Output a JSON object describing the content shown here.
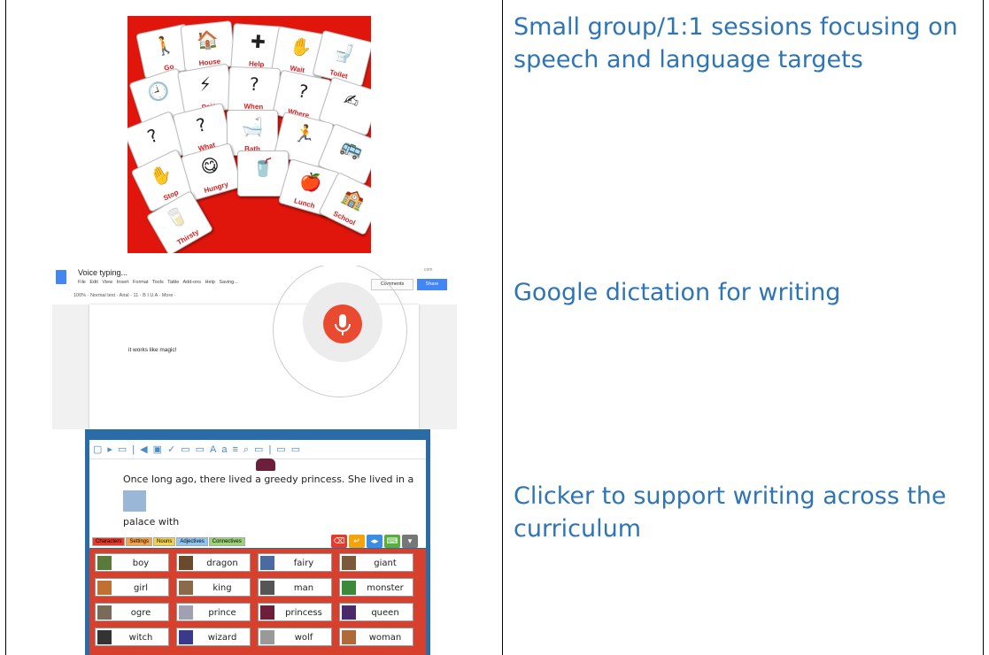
{
  "rows": [
    {
      "caption": "Small group/1:1 sessions focusing on speech and language targets"
    },
    {
      "caption": "Google dictation for writing"
    },
    {
      "caption": "Clicker to support writing across the curriculum"
    }
  ],
  "pecs_cards": [
    {
      "label": "Go",
      "symbol": "🚶"
    },
    {
      "label": "House",
      "symbol": "🏠"
    },
    {
      "label": "Help",
      "symbol": "✚"
    },
    {
      "label": "Wait",
      "symbol": "✋"
    },
    {
      "label": "Toilet",
      "symbol": "🚽"
    },
    {
      "label": "",
      "symbol": "🕘"
    },
    {
      "label": "Pain",
      "symbol": "⚡"
    },
    {
      "label": "When",
      "symbol": "?"
    },
    {
      "label": "Where",
      "symbol": "?"
    },
    {
      "label": "",
      "symbol": "✍"
    },
    {
      "label": "",
      "symbol": "?"
    },
    {
      "label": "What",
      "symbol": "?"
    },
    {
      "label": "Bath",
      "symbol": "🛁"
    },
    {
      "label": "",
      "symbol": "🏃"
    },
    {
      "label": "",
      "symbol": "🚌"
    },
    {
      "label": "Stop",
      "symbol": "✋"
    },
    {
      "label": "Hungry",
      "symbol": "😋"
    },
    {
      "label": "",
      "symbol": "🥤"
    },
    {
      "label": "Lunch",
      "symbol": "🍎"
    },
    {
      "label": "School",
      "symbol": "🏫"
    },
    {
      "label": "Thirsty",
      "symbol": "🥛"
    }
  ],
  "gdocs": {
    "title": "Voice typing...",
    "menu": "File Edit View Insert Format Tools Table Add-ons Help Saving...",
    "toolbar": "100% · Normal text · Arial · 11 · B I U A · More ·",
    "account": "com",
    "comments_label": "Comments",
    "share_label": "Share",
    "body_text": "it works like magic!"
  },
  "clicker": {
    "line1": "Once long ago, there lived a greedy princess. She lived in a",
    "line2": "palace with",
    "tabs": [
      {
        "label": "Characters",
        "color": "#e53b2a"
      },
      {
        "label": "Settings",
        "color": "#f5a34a"
      },
      {
        "label": "Nouns",
        "color": "#f2d14a"
      },
      {
        "label": "Adjectives",
        "color": "#8ec6f0"
      },
      {
        "label": "Connectives",
        "color": "#9bd27a"
      }
    ],
    "words": [
      "boy",
      "dragon",
      "fairy",
      "giant",
      "girl",
      "king",
      "man",
      "monster",
      "ogre",
      "prince",
      "princess",
      "queen",
      "witch",
      "wizard",
      "wolf",
      "woman"
    ],
    "buttons": [
      {
        "icon": "backspace-icon",
        "color": "#e53b2a",
        "glyph": "⌫"
      },
      {
        "icon": "return-icon",
        "color": "#f5a30a",
        "glyph": "↵"
      },
      {
        "icon": "listen-icon",
        "color": "#3b8de0",
        "glyph": "◂▸"
      },
      {
        "icon": "keyboard-icon",
        "color": "#5aae3c",
        "glyph": "⌨"
      },
      {
        "icon": "hide-icon",
        "color": "#777777",
        "glyph": "▾"
      }
    ]
  }
}
